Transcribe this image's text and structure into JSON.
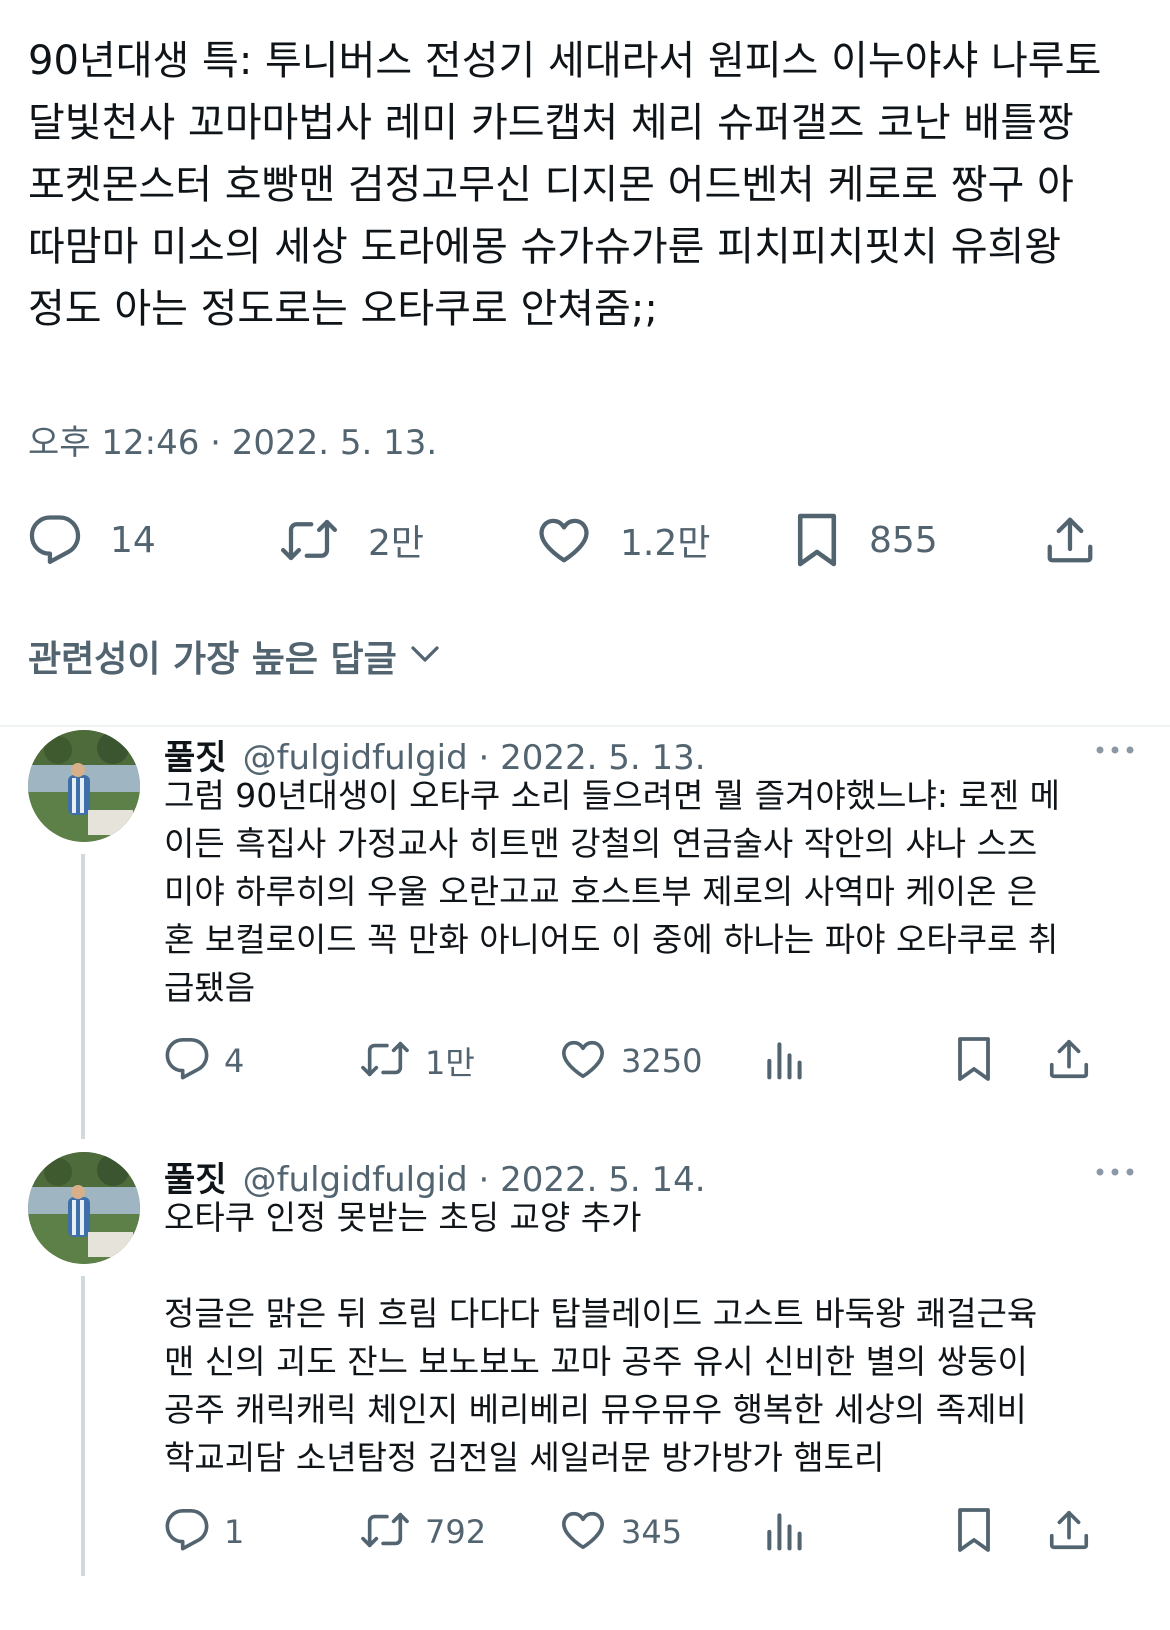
{
  "main_tweet": {
    "text": "90년대생 특: 투니버스 전성기 세대라서 원피스 이누야샤 나루토\n달빛천사 꼬마마법사 레미 카드캡처 체리 슈퍼갤즈 코난 배틀짱\n포켓몬스터 호빵맨 검정고무신 디지몬 어드벤처 케로로 짱구 아\n따맘마 미소의 세상 도라에몽 슈가슈가룬 피치피치핏치 유희왕\n정도 아는 정도로는 오타쿠로 안쳐줌;;",
    "timestamp": "오후 12:46 · 2022. 5. 13.",
    "stats": {
      "replies": "14",
      "retweets": "2만",
      "likes": "1.2만",
      "bookmarks": "855"
    }
  },
  "sort": {
    "label": "관련성이 가장 높은 답글"
  },
  "replies": [
    {
      "name": "풀짓",
      "handle": "@fulgidfulgid · 2022. 5. 13.",
      "text": "그럼 90년대생이 오타쿠 소리 들으려면 뭘 즐겨야했느냐: 로젠 메\n이든 흑집사 가정교사 히트맨 강철의 연금술사 작안의 샤나 스즈\n미야 하루히의 우울 오란고교 호스트부 제로의 사역마 케이온 은\n혼 보컬로이드 꼭 만화 아니어도 이 중에 하나는 파야 오타쿠로 취\n급됐음",
      "replies": "4",
      "retweets": "1만",
      "likes": "3250"
    },
    {
      "name": "풀짓",
      "handle": "@fulgidfulgid · 2022. 5. 14.",
      "text": "오타쿠 인정 못받는 초딩 교양 추가\n\n정글은 맑은 뒤 흐림 다다다 탑블레이드 고스트 바둑왕 쾌걸근육\n맨 신의 괴도 잔느 보노보노 꼬마 공주 유시 신비한 별의 쌍둥이\n공주 캐릭캐릭 체인지 베리베리 뮤우뮤우 행복한 세상의 족제비\n학교괴담 소년탐정 김전일 세일러문 방가방가 햄토리",
      "replies": "1",
      "retweets": "792",
      "likes": "345"
    }
  ],
  "colors": {
    "text": "#0f1419",
    "secondary": "#536471",
    "divider": "#eff3f4",
    "thread_line": "#cfd9de"
  },
  "icons": {
    "reply": "speech-bubble-icon",
    "retweet": "retweet-arrows-icon",
    "like": "heart-icon",
    "bookmark": "bookmark-icon",
    "share": "share-upload-icon",
    "views": "bar-chart-icon",
    "more": "ellipsis-icon",
    "sort": "chevron-down-icon"
  }
}
